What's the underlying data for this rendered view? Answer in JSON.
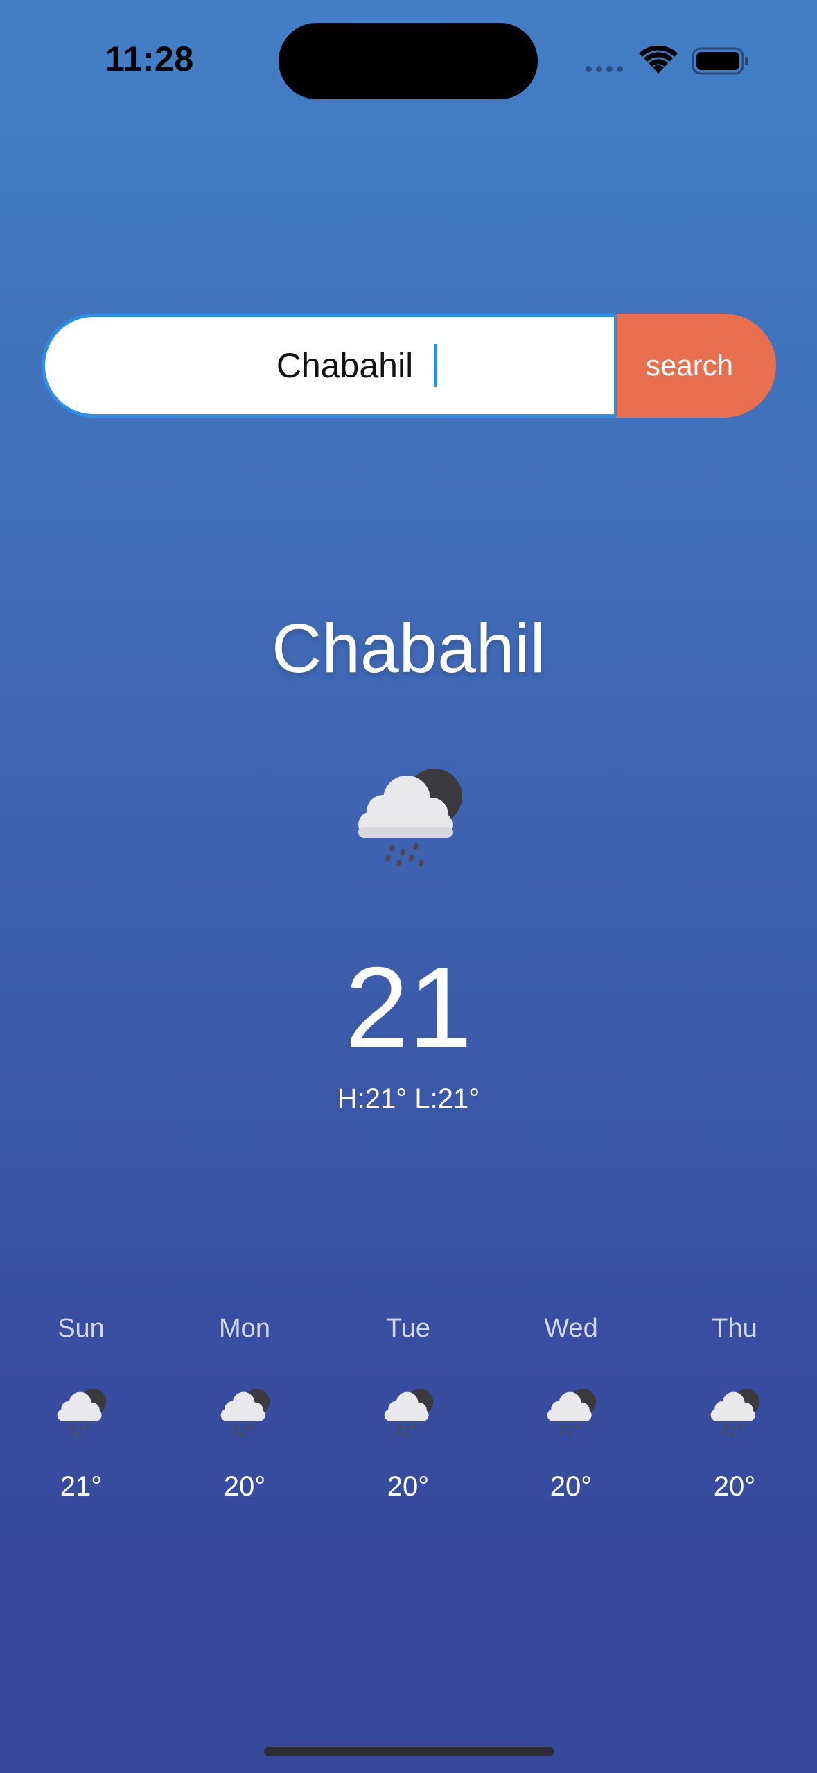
{
  "status_bar": {
    "time": "11:28",
    "wifi_icon": "wifi-icon",
    "battery_icon": "battery-icon"
  },
  "search": {
    "value": "Chabahil",
    "button_label": "search",
    "accent_color": "#2f8fe6",
    "button_color": "#e8704f"
  },
  "current": {
    "city": "Chabahil",
    "icon": "cloud-rain-moon-icon",
    "temperature": "21",
    "hi_lo": "H:21° L:21°"
  },
  "forecast": [
    {
      "day": "Sun",
      "temp": "21°",
      "icon": "cloud-rain-moon-icon"
    },
    {
      "day": "Mon",
      "temp": "20°",
      "icon": "cloud-rain-moon-icon"
    },
    {
      "day": "Tue",
      "temp": "20°",
      "icon": "cloud-rain-moon-icon"
    },
    {
      "day": "Wed",
      "temp": "20°",
      "icon": "cloud-rain-moon-icon"
    },
    {
      "day": "Thu",
      "temp": "20°",
      "icon": "cloud-rain-moon-icon"
    }
  ],
  "colors": {
    "background_top": "#437fc6",
    "background_bottom": "#36479a"
  }
}
